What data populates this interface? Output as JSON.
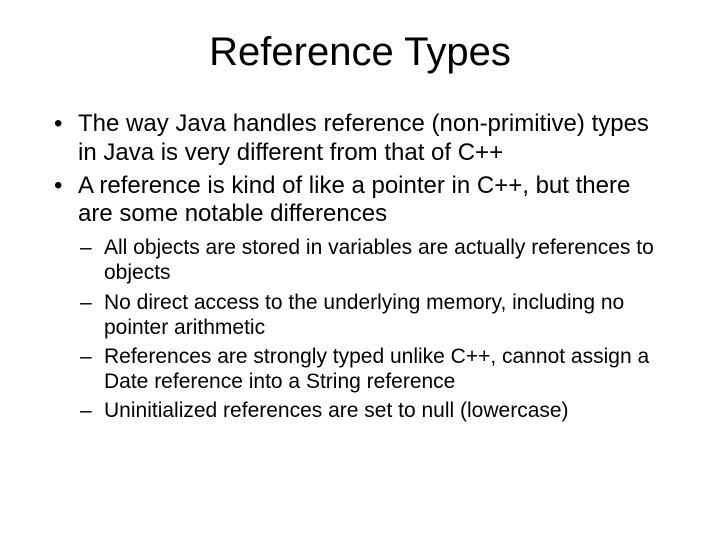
{
  "title": "Reference Types",
  "bullets": [
    "The way Java handles reference (non-primitive) types in Java is very different from that of C++",
    "A reference is kind of like a pointer in C++, but there are some notable differences"
  ],
  "subbullets": [
    "All objects are stored in variables are actually references to objects",
    "No direct access to the underlying memory, including no pointer arithmetic",
    "References are strongly typed unlike C++, cannot assign a Date reference into a String reference",
    "Uninitialized references are set to null (lowercase)"
  ]
}
